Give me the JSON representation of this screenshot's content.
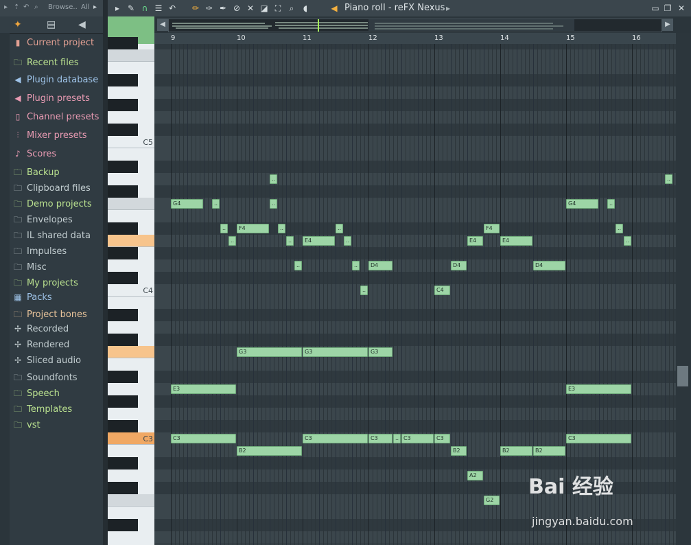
{
  "browser": {
    "top_label": "Browse..",
    "filter_label": "All",
    "items": [
      {
        "label": "Current project",
        "color": "#e3a093",
        "icon": "project-icon",
        "glyph": "▮"
      },
      {
        "label": "Recent files",
        "color": "#b9e08f",
        "icon": "folder-icon",
        "glyph": "🗀"
      },
      {
        "label": "Plugin database",
        "color": "#9ec3e8",
        "icon": "plugin-icon",
        "glyph": "◀"
      },
      {
        "label": "Plugin presets",
        "color": "#e99bb3",
        "icon": "plugin-icon",
        "glyph": "◀"
      },
      {
        "label": "Channel presets",
        "color": "#e99bb3",
        "icon": "channel-icon",
        "glyph": "▯"
      },
      {
        "label": "Mixer presets",
        "color": "#e99bb3",
        "icon": "mixer-icon",
        "glyph": "⫶"
      },
      {
        "label": "Scores",
        "color": "#e99bb3",
        "icon": "note-icon",
        "glyph": "♪"
      },
      {
        "label": "Backup",
        "color": "#b9e08f",
        "icon": "folder-icon",
        "glyph": "🗀"
      },
      {
        "label": "Clipboard files",
        "color": "#c2cdd0",
        "icon": "folder-icon",
        "glyph": "🗀"
      },
      {
        "label": "Demo projects",
        "color": "#b9e08f",
        "icon": "folder-icon",
        "glyph": "🗀"
      },
      {
        "label": "Envelopes",
        "color": "#c2cdd0",
        "icon": "folder-icon",
        "glyph": "🗀"
      },
      {
        "label": "IL shared data",
        "color": "#c2cdd0",
        "icon": "folder-icon",
        "glyph": "🗀"
      },
      {
        "label": "Impulses",
        "color": "#c2cdd0",
        "icon": "folder-icon",
        "glyph": "🗀"
      },
      {
        "label": "Misc",
        "color": "#c2cdd0",
        "icon": "folder-icon",
        "glyph": "🗀"
      },
      {
        "label": "My projects",
        "color": "#b9e08f",
        "icon": "folder-icon",
        "glyph": "🗀"
      },
      {
        "label": "Packs",
        "color": "#9ec3e8",
        "icon": "packs-icon",
        "glyph": "▦"
      },
      {
        "label": "Project bones",
        "color": "#e9c49b",
        "icon": "folder-icon",
        "glyph": "🗀"
      },
      {
        "label": "Recorded",
        "color": "#c2cdd0",
        "icon": "recorded-icon",
        "glyph": "✢"
      },
      {
        "label": "Rendered",
        "color": "#c2cdd0",
        "icon": "rendered-icon",
        "glyph": "✢"
      },
      {
        "label": "Sliced audio",
        "color": "#c2cdd0",
        "icon": "sliced-icon",
        "glyph": "✢"
      },
      {
        "label": "Soundfonts",
        "color": "#c2cdd0",
        "icon": "folder-icon",
        "glyph": "🗀"
      },
      {
        "label": "Speech",
        "color": "#b9e08f",
        "icon": "folder-icon",
        "glyph": "🗀"
      },
      {
        "label": "Templates",
        "color": "#b9e08f",
        "icon": "folder-icon",
        "glyph": "🗀"
      },
      {
        "label": "vst",
        "color": "#b9e08f",
        "icon": "folder-icon",
        "glyph": "🗀"
      }
    ]
  },
  "toolbar": {
    "title": "Piano roll - reFX Nexus"
  },
  "ruler": {
    "bars": [
      "9",
      "10",
      "11",
      "12",
      "13",
      "14",
      "15",
      "16"
    ]
  },
  "keyboard": {
    "c5": "C5",
    "c4": "C4",
    "c3": "C3"
  },
  "notes": [
    {
      "label": "..",
      "row": 11,
      "start": 1.5,
      "len": 0.12
    },
    {
      "label": "..",
      "row": 11,
      "start": 7.5,
      "len": 0.12
    },
    {
      "label": "G4",
      "row": 13,
      "start": 0,
      "len": 0.5
    },
    {
      "label": "..",
      "row": 13,
      "start": 0.625,
      "len": 0.12
    },
    {
      "label": "..",
      "row": 13,
      "start": 1.5,
      "len": 0.12
    },
    {
      "label": "G4",
      "row": 13,
      "start": 6,
      "len": 0.5
    },
    {
      "label": "..",
      "row": 13,
      "start": 6.625,
      "len": 0.12
    },
    {
      "label": "..",
      "row": 15,
      "start": 0.75,
      "len": 0.12
    },
    {
      "label": "F4",
      "row": 15,
      "start": 1,
      "len": 0.5
    },
    {
      "label": "..",
      "row": 15,
      "start": 1.625,
      "len": 0.12
    },
    {
      "label": "..",
      "row": 15,
      "start": 2.5,
      "len": 0.12
    },
    {
      "label": "F4",
      "row": 15,
      "start": 4.75,
      "len": 0.25
    },
    {
      "label": "..",
      "row": 15,
      "start": 6.75,
      "len": 0.12
    },
    {
      "label": "..",
      "row": 16,
      "start": 0.875,
      "len": 0.12
    },
    {
      "label": "..",
      "row": 16,
      "start": 1.75,
      "len": 0.12
    },
    {
      "label": "E4",
      "row": 16,
      "start": 2,
      "len": 0.5
    },
    {
      "label": "..",
      "row": 16,
      "start": 2.625,
      "len": 0.12
    },
    {
      "label": "E4",
      "row": 16,
      "start": 4.5,
      "len": 0.25
    },
    {
      "label": "E4",
      "row": 16,
      "start": 5,
      "len": 0.5
    },
    {
      "label": "..",
      "row": 16,
      "start": 6.875,
      "len": 0.12
    },
    {
      "label": "..",
      "row": 18,
      "start": 1.875,
      "len": 0.12
    },
    {
      "label": "..",
      "row": 18,
      "start": 2.75,
      "len": 0.12
    },
    {
      "label": "D4",
      "row": 18,
      "start": 3,
      "len": 0.375
    },
    {
      "label": "D4",
      "row": 18,
      "start": 4.25,
      "len": 0.25
    },
    {
      "label": "D4",
      "row": 18,
      "start": 5.5,
      "len": 0.5
    },
    {
      "label": "..",
      "row": 20,
      "start": 2.875,
      "len": 0.12
    },
    {
      "label": "C4",
      "row": 20,
      "start": 4,
      "len": 0.25
    },
    {
      "label": "G3",
      "row": 25,
      "start": 1,
      "len": 1
    },
    {
      "label": "G3",
      "row": 25,
      "start": 2,
      "len": 1
    },
    {
      "label": "G3",
      "row": 25,
      "start": 3,
      "len": 0.375
    },
    {
      "label": "E3",
      "row": 28,
      "start": 0,
      "len": 1
    },
    {
      "label": "E3",
      "row": 28,
      "start": 6,
      "len": 1
    },
    {
      "label": "C3",
      "row": 32,
      "start": 0,
      "len": 1
    },
    {
      "label": "C3",
      "row": 32,
      "start": 2,
      "len": 1
    },
    {
      "label": "C3",
      "row": 32,
      "start": 3,
      "len": 0.375
    },
    {
      "label": "..",
      "row": 32,
      "start": 3.375,
      "len": 0.125
    },
    {
      "label": "C3",
      "row": 32,
      "start": 3.5,
      "len": 0.5
    },
    {
      "label": "C3",
      "row": 32,
      "start": 4,
      "len": 0.25
    },
    {
      "label": "C3",
      "row": 32,
      "start": 6,
      "len": 1
    },
    {
      "label": "B2",
      "row": 33,
      "start": 1,
      "len": 1
    },
    {
      "label": "B2",
      "row": 33,
      "start": 4.25,
      "len": 0.25
    },
    {
      "label": "B2",
      "row": 33,
      "start": 5,
      "len": 0.5
    },
    {
      "label": "B2",
      "row": 33,
      "start": 5.5,
      "len": 0.5
    },
    {
      "label": "A2",
      "row": 35,
      "start": 4.5,
      "len": 0.25
    },
    {
      "label": "G2",
      "row": 37,
      "start": 4.75,
      "len": 0.25
    }
  ],
  "watermark": {
    "brand": "Bai 经验",
    "url": "jingyan.baidu.com"
  }
}
